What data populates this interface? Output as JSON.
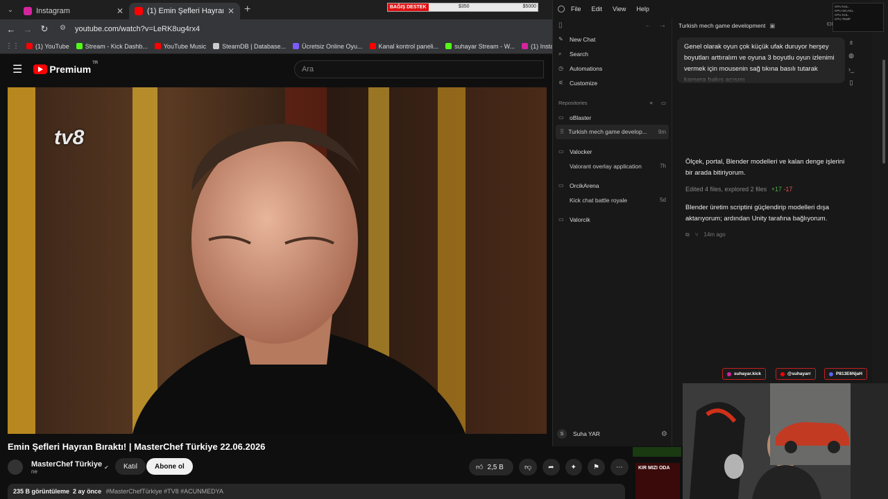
{
  "browser": {
    "tabs": [
      {
        "title": "Instagram",
        "active": false,
        "favicon_color": "#d6249f"
      },
      {
        "title": "(1) Emin Şefleri Hayran Bıral",
        "active": true,
        "favicon_color": "#ff0000"
      }
    ],
    "url": "youtube.com/watch?v=LeRK8ug4rx4",
    "bookmarks": [
      {
        "label": "(1) YouTube",
        "color": "#ff0000"
      },
      {
        "label": "Stream - Kick Dashb...",
        "color": "#53fc18"
      },
      {
        "label": "YouTube Music",
        "color": "#ff0000"
      },
      {
        "label": "SteamDB | Database...",
        "color": "#cccccc"
      },
      {
        "label": "Ücretsiz Online Oyu...",
        "color": "#7b5cff"
      },
      {
        "label": "Kanal kontrol paneli...",
        "color": "#ff0000"
      },
      {
        "label": "suhayar Stream - W...",
        "color": "#53fc18"
      },
      {
        "label": "(1) Instagram",
        "color": "#d6249f"
      },
      {
        "label": "Su",
        "color": "#222222"
      }
    ]
  },
  "donation": {
    "label": "BAĞIŞ DESTEK",
    "current": "$350",
    "goal": "$5000",
    "progress": 0.07
  },
  "youtube": {
    "logo": "Premium",
    "region": "TR",
    "search_placeholder": "Ara",
    "video_logo": "tv8",
    "title": "Emin Şefleri Hayran Bıraktı! | MasterChef Türkiye 22.06.2026",
    "channel": "MasterChef Türkiye",
    "subscribers": "ne",
    "join_label": "Katıl",
    "subscribe_label": "Abone ol",
    "likes": "2,5 B",
    "views": "235 B görüntüleme",
    "age": "2 ay önce",
    "tags": "#MasterChefTürkiye #TV8 #ACUNMEDYA"
  },
  "app": {
    "menu": [
      "File",
      "Edit",
      "View",
      "Help"
    ],
    "nav": [
      {
        "label": "New Chat",
        "icon": "edit-icon"
      },
      {
        "label": "Search",
        "icon": "search-icon"
      },
      {
        "label": "Automations",
        "icon": "clock-icon"
      },
      {
        "label": "Customize",
        "icon": "sliders-icon"
      }
    ],
    "repositories_label": "Repositories",
    "repos": [
      {
        "name": "oBlaster",
        "threads": []
      },
      {
        "name": "Turkish mech game develop...",
        "threads": [],
        "selected": true,
        "time": "9m"
      },
      {
        "name": "Valocker",
        "threads": [
          {
            "title": "Valorant overlay application",
            "time": "7h"
          }
        ]
      },
      {
        "name": "OrcikArena",
        "threads": [
          {
            "title": "Kick chat battle royale",
            "time": "5d"
          }
        ]
      },
      {
        "name": "Valorcik",
        "threads": []
      }
    ],
    "user": {
      "initial": "S",
      "name": "Suha YAR"
    },
    "chat_title": "Turkish mech game development",
    "ide_label": "IDE",
    "user_message": "Genel olarak oyun çok küçük ufak duruyor herşey boyutları arttıralım ve oyuna 3 boyutlu oyun izlenimi vermek için mousenin sağ tıkına basılı tutarak kamera bakış açısını",
    "msg1": "Ölçek, portal, Blender modelleri ve kalan denge işlerini bir arada bitiriyorum.",
    "edited_prefix": "Edited",
    "edited_files": "4 files, explored 2 files",
    "added": "+17",
    "removed": "-17",
    "msg2": "Blender üretim scriptini güçlendirip modelleri dışa aktarıyorum; ardından Unity tarafına bağlıyorum.",
    "ago": "14m ago"
  },
  "overlay": {
    "sysmon": [
      "GPU KUL.",
      "GPU SICAKL.",
      "CPU KUL.",
      "CPU TEMP"
    ],
    "socials": [
      {
        "label": "suhayar.kick",
        "color": "#d6249f"
      },
      {
        "label": "@suhayarr",
        "color": "#ff0000"
      },
      {
        "label": "P813E6NjaH",
        "color": "#5865f2"
      }
    ],
    "thumb_text": "KIR MIZI ODA"
  }
}
